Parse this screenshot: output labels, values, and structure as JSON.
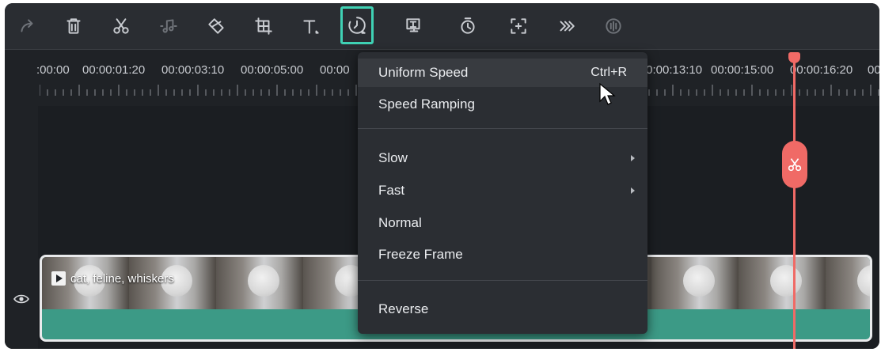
{
  "toolbar": {
    "icons": [
      "redo-icon",
      "delete-icon",
      "cut-icon",
      "audio-icon",
      "tag-icon",
      "crop-icon",
      "text-icon",
      "speed-icon",
      "ai-portrait-icon",
      "duration-icon",
      "auto-reframe-icon",
      "keyframe-icon",
      "audio-stretch-icon"
    ],
    "active": "speed-icon"
  },
  "ruler": {
    "timecodes_left": [
      ":00:00",
      "00:00:01:20",
      "00:00:03:10",
      "00:00:05:00",
      "00:00"
    ],
    "timecodes_right": [
      ":0:00:13:10",
      "00:00:15:00",
      "00:00:16:20",
      "00"
    ]
  },
  "clip": {
    "label": "cat, feline, whiskers"
  },
  "menu": {
    "items": [
      {
        "label": "Uniform Speed",
        "shortcut": "Ctrl+R"
      },
      {
        "label": "Speed Ramping"
      },
      {
        "label": "Slow"
      },
      {
        "label": "Fast"
      },
      {
        "label": "Normal"
      },
      {
        "label": "Freeze Frame"
      },
      {
        "label": "Reverse"
      }
    ]
  },
  "colors": {
    "accent": "#3fd1b4",
    "playhead": "#f06a66",
    "clip_track": "#3c9a86",
    "menu_bg": "#2b2e33"
  }
}
